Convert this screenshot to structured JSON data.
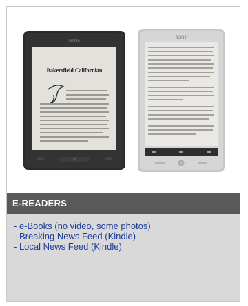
{
  "section": {
    "title": "E-READERS",
    "features": [
      "e-Books (no video, some photos)",
      "Breaking News Feed (Kindle)",
      "Local News Feed (Kindle)"
    ]
  },
  "image": {
    "kindle_logo_text": "kindle",
    "sony_logo_text": "SONY",
    "kindle_screen_title": "Bakersfield Californian"
  },
  "colors": {
    "header_bg": "#5a5a5a",
    "body_bg": "#d9d9d9",
    "link_text": "#1a3e9a",
    "kindle_body": "#2b2b2b",
    "sony_body": "#c8c8c8"
  }
}
